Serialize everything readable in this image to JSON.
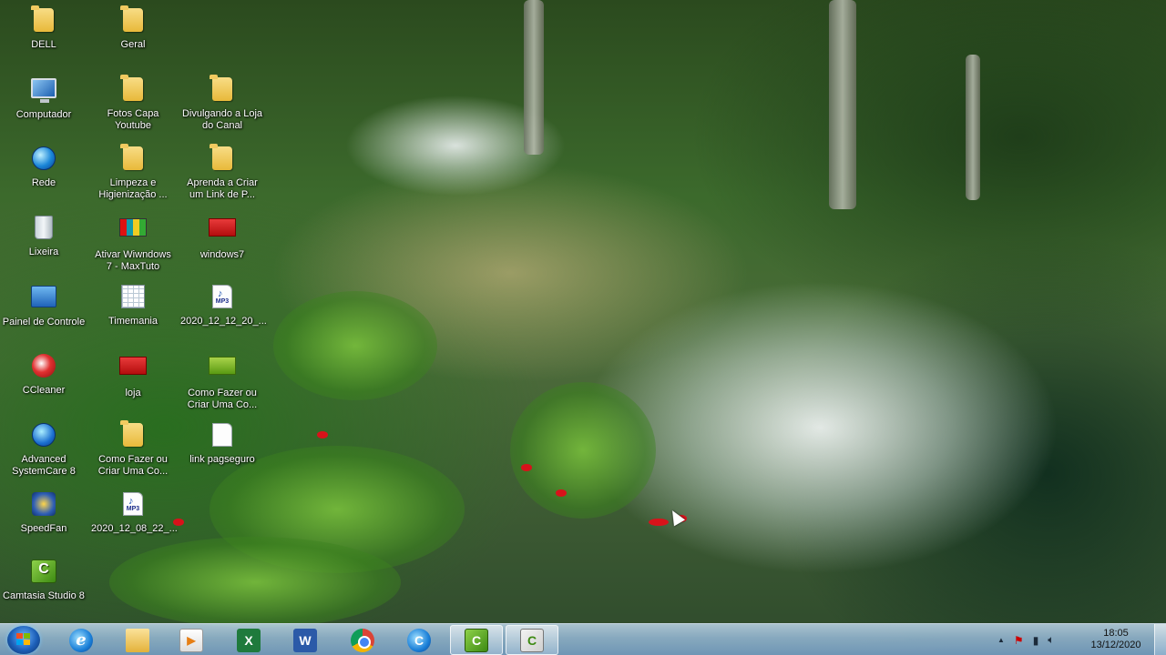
{
  "desktop": {
    "icons": [
      {
        "label": "DELL",
        "icon": "folder-icon"
      },
      {
        "label": "Geral",
        "icon": "folder-icon"
      },
      {
        "label": "Computador",
        "icon": "computer-icon"
      },
      {
        "label": "Fotos Capa Youtube",
        "icon": "folder-icon"
      },
      {
        "label": "Divulgando a Loja do Canal",
        "icon": "folder-icon"
      },
      {
        "label": "Rede",
        "icon": "network-globe-icon"
      },
      {
        "label": "Limpeza e Higienização ...",
        "icon": "folder-icon"
      },
      {
        "label": "Aprenda a Criar um Link de P...",
        "icon": "folder-icon"
      },
      {
        "label": "Lixeira",
        "icon": "recycle-bin-icon"
      },
      {
        "label": "Ativar Wiwndows 7 - MaxTuto",
        "icon": "activator-icon"
      },
      {
        "label": "windows7",
        "icon": "red-image-icon"
      },
      {
        "label": "Painel de Controle",
        "icon": "control-panel-icon"
      },
      {
        "label": "Timemania",
        "icon": "spreadsheet-icon"
      },
      {
        "label": "2020_12_12_20_...",
        "icon": "mp3-file-icon"
      },
      {
        "label": "CCleaner",
        "icon": "ccleaner-icon"
      },
      {
        "label": "loja",
        "icon": "red-image-icon"
      },
      {
        "label": "Como Fazer ou Criar Uma Co...",
        "icon": "green-image-icon"
      },
      {
        "label": "Advanced SystemCare 8",
        "icon": "advanced-systemcare-icon"
      },
      {
        "label": "Como Fazer ou Criar Uma Co...",
        "icon": "folder-icon"
      },
      {
        "label": "link pagseguro",
        "icon": "text-file-icon"
      },
      {
        "label": "SpeedFan",
        "icon": "speedfan-icon"
      },
      {
        "label": "2020_12_08_22_...",
        "icon": "mp3-file-icon"
      },
      {
        "label": "Camtasia Studio 8",
        "icon": "camtasia-icon"
      }
    ]
  },
  "taskbar": {
    "pinned": [
      {
        "name": "internet-explorer-icon",
        "glyph": "e"
      },
      {
        "name": "file-explorer-icon",
        "glyph": ""
      },
      {
        "name": "media-player-icon",
        "glyph": "▶"
      },
      {
        "name": "excel-icon",
        "glyph": "X"
      },
      {
        "name": "word-icon",
        "glyph": "W"
      },
      {
        "name": "chrome-icon",
        "glyph": ""
      },
      {
        "name": "ie-blue-icon",
        "glyph": "C"
      },
      {
        "name": "camtasia-studio-icon",
        "glyph": "C"
      },
      {
        "name": "camtasia-recorder-icon",
        "glyph": "C"
      }
    ],
    "tray": {
      "show_hidden": "▲",
      "time": "18:05",
      "date": "13/12/2020"
    }
  },
  "colors": {
    "taskbar": "#9ab9d8",
    "start_orb": "#1c5fb8"
  }
}
